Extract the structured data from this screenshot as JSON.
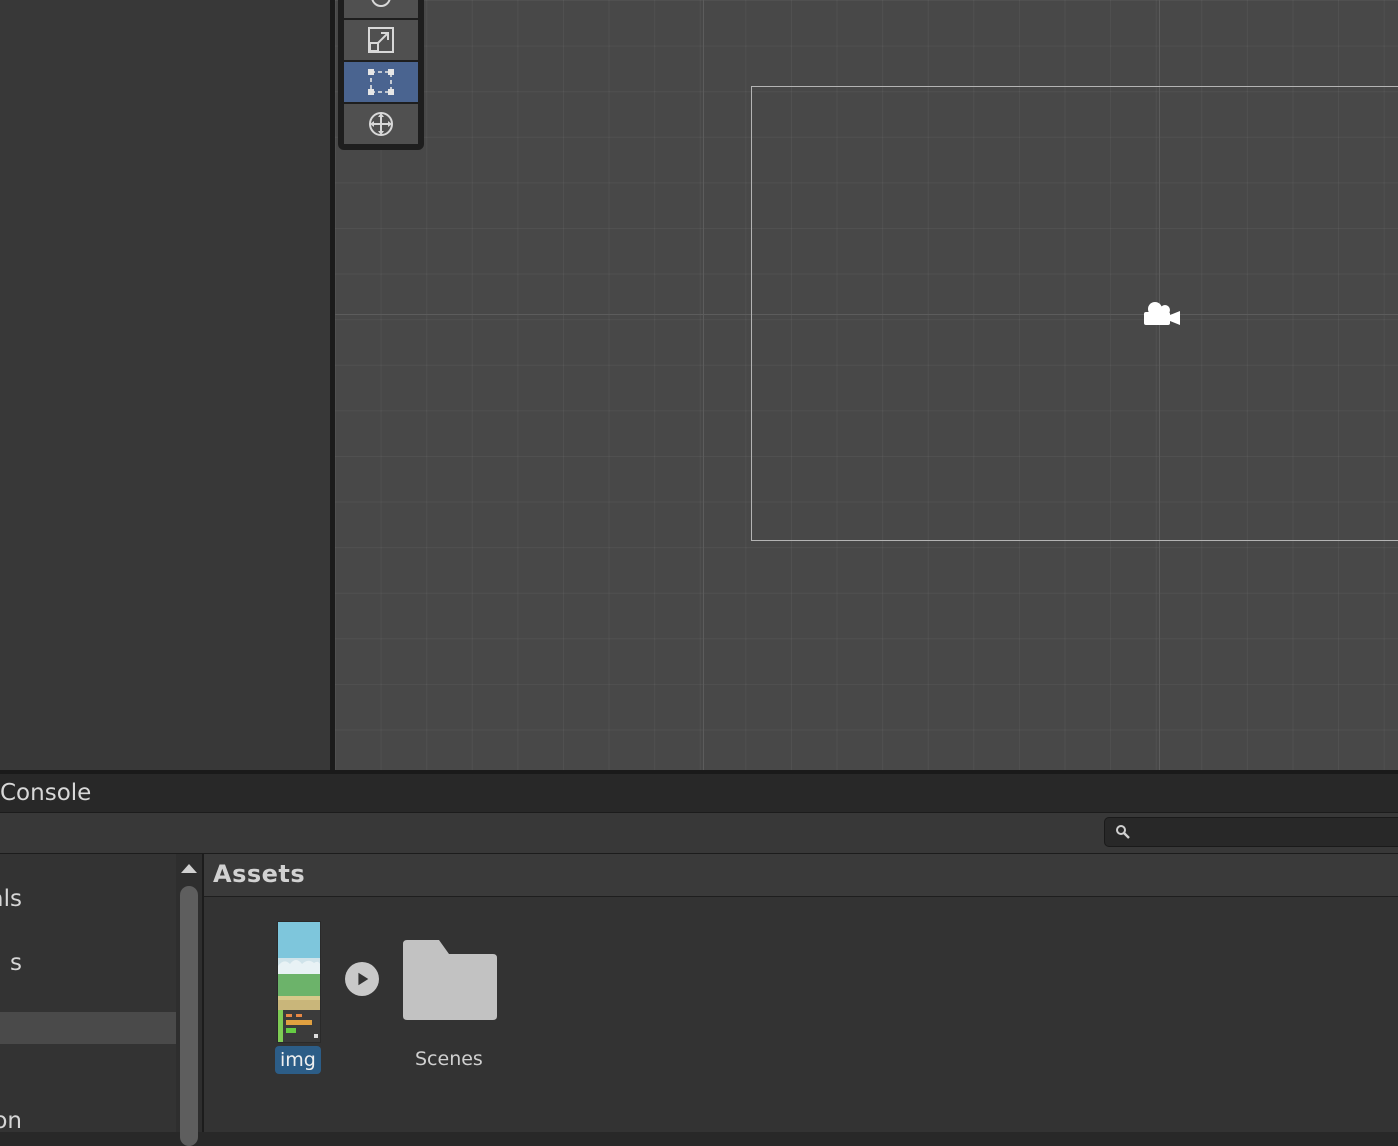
{
  "console_tab": {
    "label": "Console"
  },
  "search": {
    "placeholder": "",
    "value": ""
  },
  "tree": {
    "items": [
      {
        "label": "als"
      },
      {
        "label": "s"
      },
      {
        "label": ""
      },
      {
        "label": "ion"
      }
    ]
  },
  "assets": {
    "title": "Assets",
    "items": [
      {
        "label": "img",
        "type": "image",
        "selected": true
      },
      {
        "label": "Scenes",
        "type": "folder"
      }
    ]
  },
  "tools": [
    {
      "name": "rotate-tool",
      "active": false
    },
    {
      "name": "scale-tool",
      "active": false
    },
    {
      "name": "rect-tool",
      "active": true
    },
    {
      "name": "transform-tool",
      "active": false
    }
  ],
  "colors": {
    "scene_bg": "#484848",
    "selection_accent": "#2c5d87",
    "active_tool": "#4a6490"
  }
}
